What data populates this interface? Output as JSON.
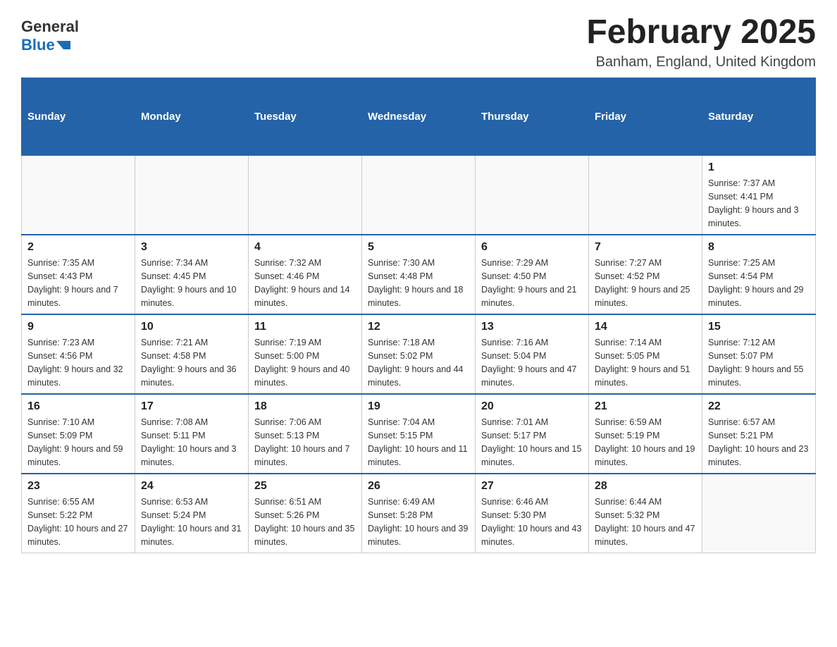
{
  "header": {
    "logo_general": "General",
    "logo_blue": "Blue",
    "title": "February 2025",
    "location": "Banham, England, United Kingdom"
  },
  "weekdays": [
    "Sunday",
    "Monday",
    "Tuesday",
    "Wednesday",
    "Thursday",
    "Friday",
    "Saturday"
  ],
  "weeks": [
    [
      {
        "day": "",
        "info": ""
      },
      {
        "day": "",
        "info": ""
      },
      {
        "day": "",
        "info": ""
      },
      {
        "day": "",
        "info": ""
      },
      {
        "day": "",
        "info": ""
      },
      {
        "day": "",
        "info": ""
      },
      {
        "day": "1",
        "info": "Sunrise: 7:37 AM\nSunset: 4:41 PM\nDaylight: 9 hours and 3 minutes."
      }
    ],
    [
      {
        "day": "2",
        "info": "Sunrise: 7:35 AM\nSunset: 4:43 PM\nDaylight: 9 hours and 7 minutes."
      },
      {
        "day": "3",
        "info": "Sunrise: 7:34 AM\nSunset: 4:45 PM\nDaylight: 9 hours and 10 minutes."
      },
      {
        "day": "4",
        "info": "Sunrise: 7:32 AM\nSunset: 4:46 PM\nDaylight: 9 hours and 14 minutes."
      },
      {
        "day": "5",
        "info": "Sunrise: 7:30 AM\nSunset: 4:48 PM\nDaylight: 9 hours and 18 minutes."
      },
      {
        "day": "6",
        "info": "Sunrise: 7:29 AM\nSunset: 4:50 PM\nDaylight: 9 hours and 21 minutes."
      },
      {
        "day": "7",
        "info": "Sunrise: 7:27 AM\nSunset: 4:52 PM\nDaylight: 9 hours and 25 minutes."
      },
      {
        "day": "8",
        "info": "Sunrise: 7:25 AM\nSunset: 4:54 PM\nDaylight: 9 hours and 29 minutes."
      }
    ],
    [
      {
        "day": "9",
        "info": "Sunrise: 7:23 AM\nSunset: 4:56 PM\nDaylight: 9 hours and 32 minutes."
      },
      {
        "day": "10",
        "info": "Sunrise: 7:21 AM\nSunset: 4:58 PM\nDaylight: 9 hours and 36 minutes."
      },
      {
        "day": "11",
        "info": "Sunrise: 7:19 AM\nSunset: 5:00 PM\nDaylight: 9 hours and 40 minutes."
      },
      {
        "day": "12",
        "info": "Sunrise: 7:18 AM\nSunset: 5:02 PM\nDaylight: 9 hours and 44 minutes."
      },
      {
        "day": "13",
        "info": "Sunrise: 7:16 AM\nSunset: 5:04 PM\nDaylight: 9 hours and 47 minutes."
      },
      {
        "day": "14",
        "info": "Sunrise: 7:14 AM\nSunset: 5:05 PM\nDaylight: 9 hours and 51 minutes."
      },
      {
        "day": "15",
        "info": "Sunrise: 7:12 AM\nSunset: 5:07 PM\nDaylight: 9 hours and 55 minutes."
      }
    ],
    [
      {
        "day": "16",
        "info": "Sunrise: 7:10 AM\nSunset: 5:09 PM\nDaylight: 9 hours and 59 minutes."
      },
      {
        "day": "17",
        "info": "Sunrise: 7:08 AM\nSunset: 5:11 PM\nDaylight: 10 hours and 3 minutes."
      },
      {
        "day": "18",
        "info": "Sunrise: 7:06 AM\nSunset: 5:13 PM\nDaylight: 10 hours and 7 minutes."
      },
      {
        "day": "19",
        "info": "Sunrise: 7:04 AM\nSunset: 5:15 PM\nDaylight: 10 hours and 11 minutes."
      },
      {
        "day": "20",
        "info": "Sunrise: 7:01 AM\nSunset: 5:17 PM\nDaylight: 10 hours and 15 minutes."
      },
      {
        "day": "21",
        "info": "Sunrise: 6:59 AM\nSunset: 5:19 PM\nDaylight: 10 hours and 19 minutes."
      },
      {
        "day": "22",
        "info": "Sunrise: 6:57 AM\nSunset: 5:21 PM\nDaylight: 10 hours and 23 minutes."
      }
    ],
    [
      {
        "day": "23",
        "info": "Sunrise: 6:55 AM\nSunset: 5:22 PM\nDaylight: 10 hours and 27 minutes."
      },
      {
        "day": "24",
        "info": "Sunrise: 6:53 AM\nSunset: 5:24 PM\nDaylight: 10 hours and 31 minutes."
      },
      {
        "day": "25",
        "info": "Sunrise: 6:51 AM\nSunset: 5:26 PM\nDaylight: 10 hours and 35 minutes."
      },
      {
        "day": "26",
        "info": "Sunrise: 6:49 AM\nSunset: 5:28 PM\nDaylight: 10 hours and 39 minutes."
      },
      {
        "day": "27",
        "info": "Sunrise: 6:46 AM\nSunset: 5:30 PM\nDaylight: 10 hours and 43 minutes."
      },
      {
        "day": "28",
        "info": "Sunrise: 6:44 AM\nSunset: 5:32 PM\nDaylight: 10 hours and 47 minutes."
      },
      {
        "day": "",
        "info": ""
      }
    ]
  ]
}
